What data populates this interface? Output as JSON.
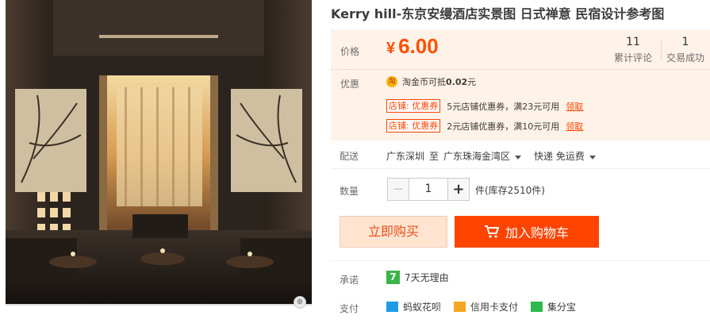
{
  "product": {
    "title": "Kerry hill-东京安缦酒店实景图 日式禅意 民宿设计参考图",
    "image_icon": "zoom-icon"
  },
  "price": {
    "label": "价格",
    "currency": "¥",
    "amount": "6.00",
    "color": "#ff5000"
  },
  "stats": {
    "reviews_count": "11",
    "reviews_label": "累计评论",
    "deals_count": "1",
    "deals_label": "交易成功"
  },
  "promotions": {
    "label": "优惠",
    "coin_icon_text": "淘",
    "coin_text_prefix": "淘金币可抵",
    "coin_text_amount": "0.02",
    "coin_text_suffix": "元",
    "coupons": [
      {
        "tag": "店铺: 优惠券",
        "text": "5元店铺优惠券，满23元可用",
        "claim": "领取"
      },
      {
        "tag": "店铺: 优惠券",
        "text": "2元店铺优惠券，满10元可用",
        "claim": "领取"
      }
    ]
  },
  "shipping": {
    "label": "配送",
    "from": "广东深圳",
    "to_word": "至",
    "to": "广东珠海金湾区",
    "method": "快递 免运费"
  },
  "quantity": {
    "label": "数量",
    "minus": "−",
    "value": "1",
    "plus": "+",
    "stock": "件(库存2510件)"
  },
  "actions": {
    "buy_now": "立即购买",
    "add_to_cart": "加入购物车",
    "accent": "#ff4400"
  },
  "promise": {
    "label": "承诺",
    "badge": "7",
    "text": "7天无理由"
  },
  "payment": {
    "label": "支付",
    "items": [
      "蚂蚁花呗",
      "信用卡支付",
      "集分宝"
    ]
  }
}
